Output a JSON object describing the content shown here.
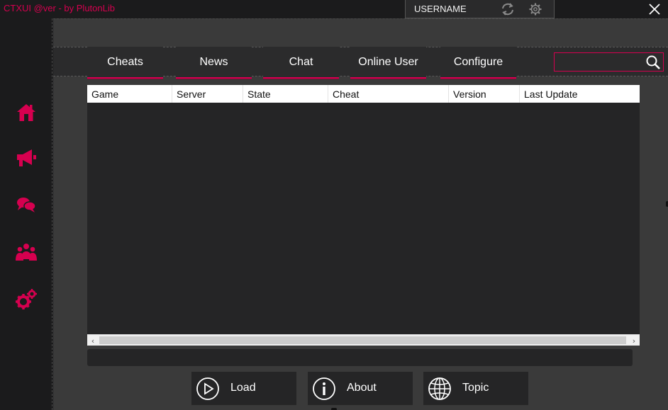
{
  "app": {
    "title": "CTXUI @ver - by PlutonLib",
    "username": "USERNAME",
    "accent_color": "#d6004f"
  },
  "titlebar_icons": [
    "refresh-icon",
    "gear-icon",
    "close-icon"
  ],
  "sidebar": {
    "items": [
      {
        "name": "home",
        "icon": "home-icon"
      },
      {
        "name": "news",
        "icon": "megaphone-icon"
      },
      {
        "name": "chat",
        "icon": "chat-bubbles-icon"
      },
      {
        "name": "online-users",
        "icon": "users-group-icon"
      },
      {
        "name": "configure",
        "icon": "gears-icon"
      }
    ]
  },
  "tabs": [
    {
      "label": "Cheats"
    },
    {
      "label": "News"
    },
    {
      "label": "Chat"
    },
    {
      "label": "Online User"
    },
    {
      "label": "Configure"
    }
  ],
  "search": {
    "value": "",
    "placeholder": "",
    "icon": "search-icon"
  },
  "table": {
    "columns": [
      "Game",
      "Server",
      "State",
      "Cheat",
      "Version",
      "Last Update"
    ],
    "rows": []
  },
  "progress": {
    "value": 0
  },
  "actions": [
    {
      "label": "Load",
      "icon": "play-icon"
    },
    {
      "label": "About",
      "icon": "info-icon"
    },
    {
      "label": "Topic",
      "icon": "globe-icon"
    }
  ]
}
